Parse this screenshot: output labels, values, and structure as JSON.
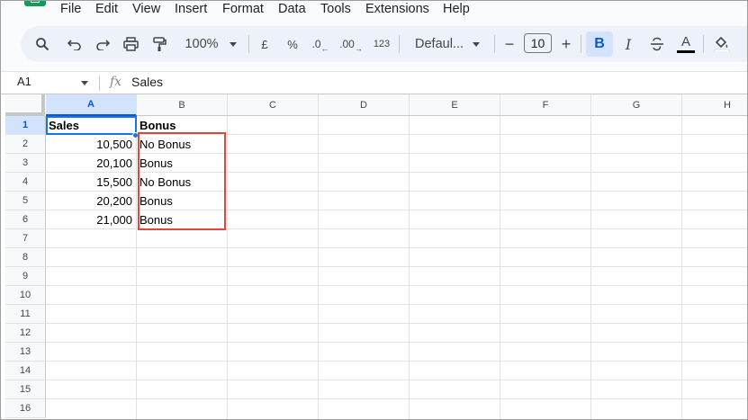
{
  "menu": [
    "File",
    "Edit",
    "View",
    "Insert",
    "Format",
    "Data",
    "Tools",
    "Extensions",
    "Help"
  ],
  "toolbar": {
    "zoom": "100%",
    "currency": "£",
    "percent": "%",
    "decrease_decimal": ".0",
    "increase_decimal": ".00",
    "number_format": "123",
    "font": "Defaul...",
    "font_size": "10",
    "minus": "−",
    "plus": "+",
    "bold": "B",
    "italic": "I",
    "text_color_bar": "#000000",
    "bold_active_color": "#d3e3fd"
  },
  "formula_bar": {
    "cell_ref": "A1",
    "fx": "fx",
    "value": "Sales"
  },
  "columns": [
    "A",
    "B",
    "C",
    "D",
    "E",
    "F",
    "G",
    "H"
  ],
  "rows": [
    "1",
    "2",
    "3",
    "4",
    "5",
    "6",
    "7",
    "8",
    "9",
    "10",
    "11",
    "12",
    "13",
    "14",
    "15",
    "16"
  ],
  "cells": {
    "A1": "Sales",
    "B1": "Bonus",
    "A2": "10,500",
    "B2": "No Bonus",
    "A3": "20,100",
    "B3": "Bonus",
    "A4": "15,500",
    "B4": "No Bonus",
    "A5": "20,200",
    "B5": "Bonus",
    "A6": "21,000",
    "B6": "Bonus"
  },
  "colors": {
    "selection": "#1a73e8",
    "highlight_box": "#e2463b",
    "sheets_green": "#0f9d58"
  }
}
